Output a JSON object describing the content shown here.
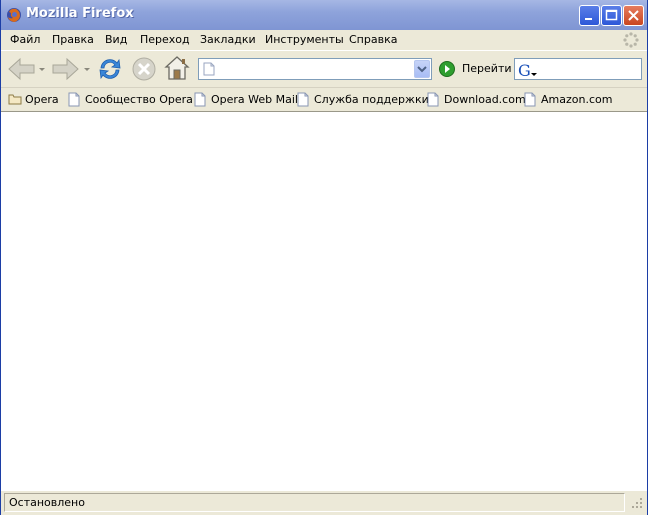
{
  "window": {
    "title": "Mozilla Firefox",
    "app_icon": "firefox-icon",
    "controls": [
      "minimize-icon",
      "maximize-icon",
      "close-icon"
    ]
  },
  "menubar": {
    "items": [
      {
        "label": "Файл"
      },
      {
        "label": "Правка"
      },
      {
        "label": "Вид"
      },
      {
        "label": "Переход"
      },
      {
        "label": "Закладки"
      },
      {
        "label": "Инструменты"
      },
      {
        "label": "Справка"
      }
    ],
    "throbber_icon": "throbber-icon"
  },
  "navbar": {
    "back_icon": "back-arrow-icon",
    "forward_icon": "forward-arrow-icon",
    "reload_icon": "reload-icon",
    "stop_icon": "stop-icon",
    "home_icon": "home-icon",
    "url": {
      "value": "",
      "placeholder": ""
    },
    "go_label": "Перейти",
    "search": {
      "value": "",
      "engine_icon": "google-icon"
    }
  },
  "bookmarks": {
    "items": [
      {
        "label": "Opera",
        "icon": "folder-icon"
      },
      {
        "label": "Сообщество Opera",
        "icon": "page-icon"
      },
      {
        "label": "Opera Web Mail",
        "icon": "page-icon"
      },
      {
        "label": "Служба поддержки",
        "icon": "page-icon"
      },
      {
        "label": "Download.com",
        "icon": "page-icon"
      },
      {
        "label": "Amazon.com",
        "icon": "page-icon"
      }
    ]
  },
  "status": {
    "text": "Остановлено"
  },
  "colors": {
    "titlebar": "#8ea3db",
    "chrome": "#ece9d8",
    "content": "#ffffff",
    "go_green": "#2f9e2f"
  }
}
